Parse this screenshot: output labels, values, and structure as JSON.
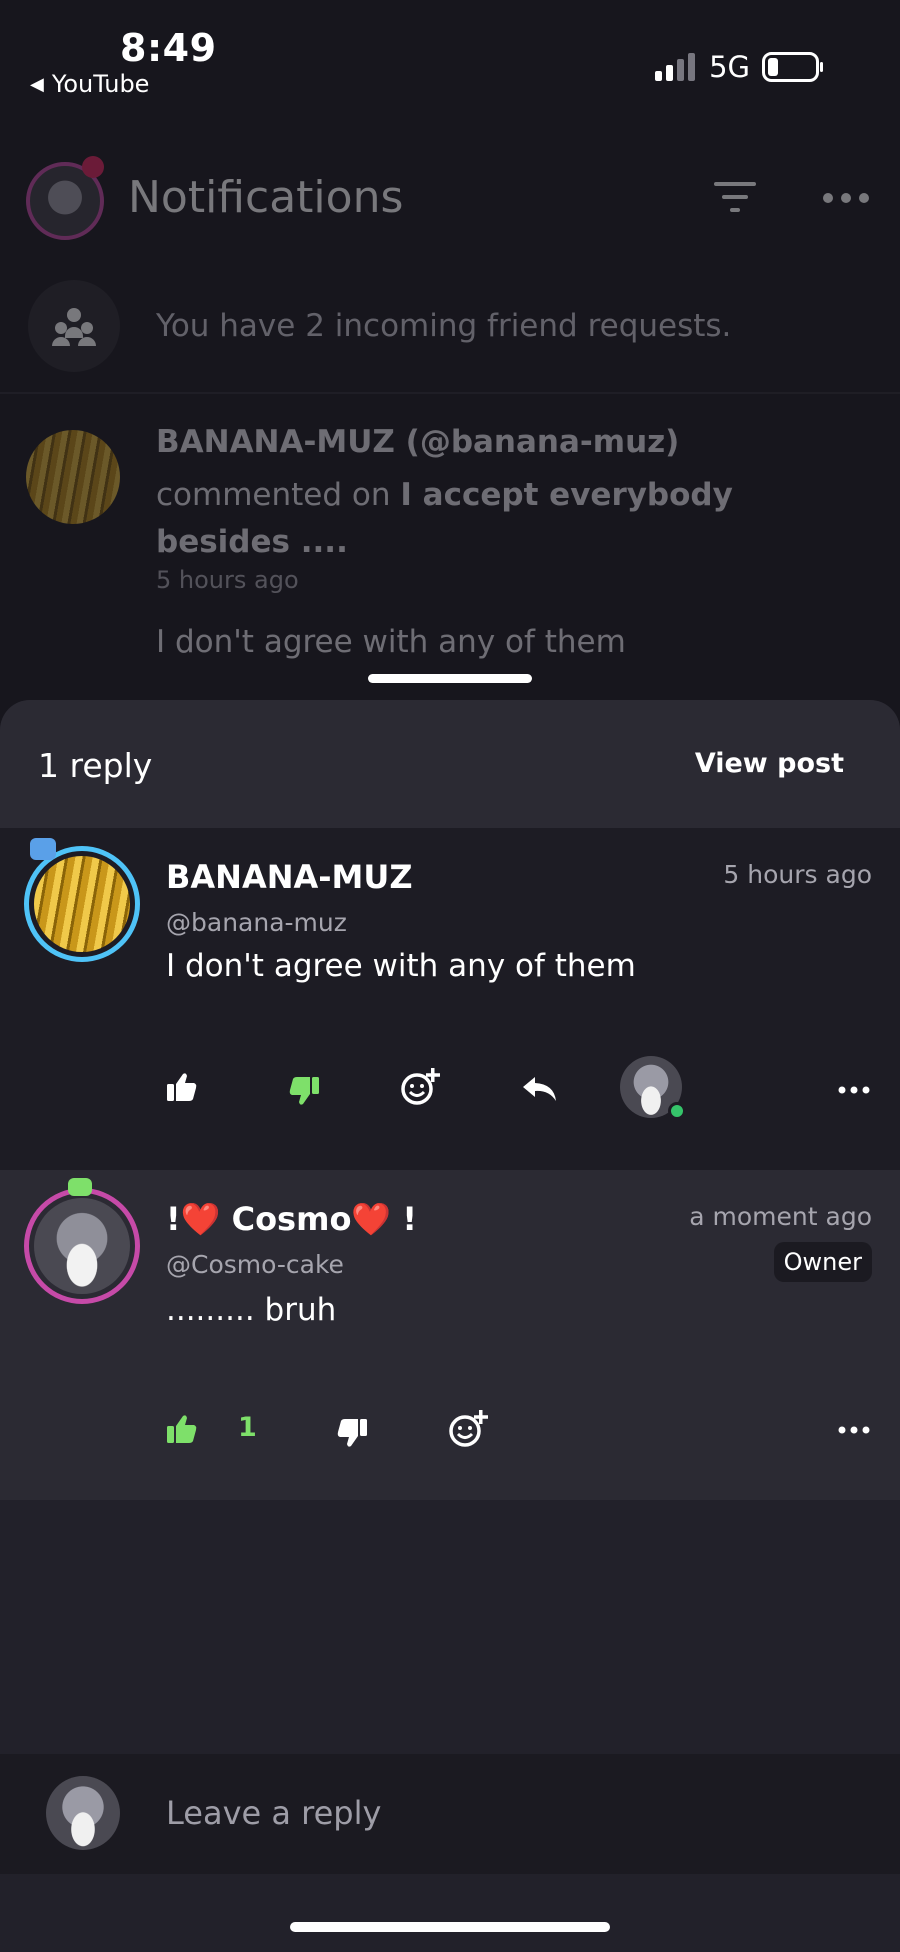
{
  "status_bar": {
    "time": "8:49",
    "back_app": "YouTube",
    "network": "5G"
  },
  "notifications": {
    "title": "Notifications",
    "friend_requests_text": "You have 2 incoming friend requests.",
    "comment_notification": {
      "actor": "BANANA-MUZ (@banana-muz)",
      "action": "commented on ",
      "post_title": "I accept everybody besides ....",
      "time": "5 hours ago",
      "body": "I don't agree with any of them"
    }
  },
  "sheet": {
    "reply_count": "1 reply",
    "view_post_label": "View post",
    "comments": [
      {
        "name": "BANANA-MUZ",
        "handle": "@banana-muz",
        "time": "5 hours ago",
        "text": "I don't agree with any of them",
        "thumbs_up_active": false,
        "thumbs_down_active": true
      },
      {
        "name": "!❤️ Cosmo❤️ !",
        "handle": "@Cosmo-cake",
        "time": "a moment ago",
        "badge": "Owner",
        "text": "......... bruh",
        "likes": "1",
        "thumbs_up_active": true
      }
    ]
  },
  "reply_input": {
    "placeholder": "Leave a reply"
  },
  "colors": {
    "background": "#17161d",
    "sheet": "#22212a",
    "accent_green": "#7ee06a",
    "ring_pink": "#c64aa8",
    "ring_blue": "#4fc3f7"
  }
}
